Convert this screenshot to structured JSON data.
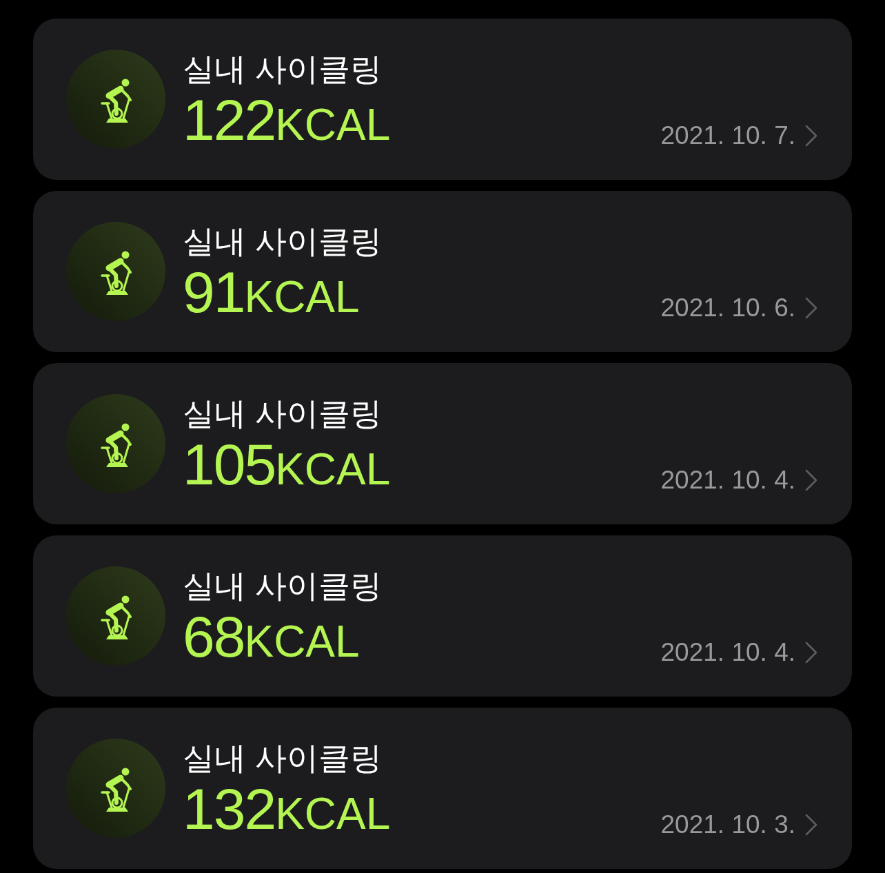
{
  "workouts": [
    {
      "title": "실내 사이클링",
      "calories": "122",
      "unit": "KCAL",
      "date": "2021. 10. 7."
    },
    {
      "title": "실내 사이클링",
      "calories": "91",
      "unit": "KCAL",
      "date": "2021. 10. 6."
    },
    {
      "title": "실내 사이클링",
      "calories": "105",
      "unit": "KCAL",
      "date": "2021. 10. 4."
    },
    {
      "title": "실내 사이클링",
      "calories": "68",
      "unit": "KCAL",
      "date": "2021. 10. 4."
    },
    {
      "title": "실내 사이클링",
      "calories": "132",
      "unit": "KCAL",
      "date": "2021. 10. 3."
    }
  ]
}
